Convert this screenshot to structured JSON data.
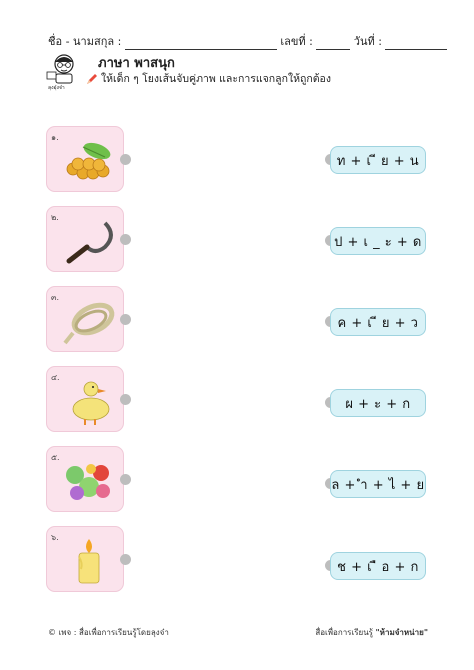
{
  "header": {
    "name_label": "ชื่อ - นามสกุล :",
    "number_label": "เลขที่ :",
    "date_label": "วันที่ :"
  },
  "title": "ภาษา พาสนุก",
  "instruction": "ให้เด็ก ๆ โยงเส้นจับคู่ภาพ และการแจกลูกให้ถูกต้อง",
  "logo_caption": "ลุงอุ๋งจ๋า",
  "pictures": [
    {
      "num": "๑.",
      "icon": "longan-icon"
    },
    {
      "num": "๒.",
      "icon": "sickle-icon"
    },
    {
      "num": "๓.",
      "icon": "rope-icon"
    },
    {
      "num": "๔.",
      "icon": "duck-icon"
    },
    {
      "num": "๕.",
      "icon": "vegetables-icon"
    },
    {
      "num": "๖.",
      "icon": "candle-icon"
    }
  ],
  "answers": [
    "ท + เ ี ย + น",
    "ป + เ _ ะ + ด",
    "ค + เ ี ย + ว",
    "ผ + ะ + ก",
    "ล + ำ + ไ + ย",
    "ช + เ ื อ + ก"
  ],
  "footer": {
    "left": "© เพจ : สื่อเพื่อการเรียนรู้โดยลุงจ๋า",
    "right_prefix": "สื่อเพื่อการเรียนรู้",
    "right_bold": "\"ห้ามจำหน่าย\""
  },
  "colors": {
    "card_bg": "#fbe3ec",
    "pill_bg": "#d9f2f7",
    "dot": "#bdbdbd"
  }
}
